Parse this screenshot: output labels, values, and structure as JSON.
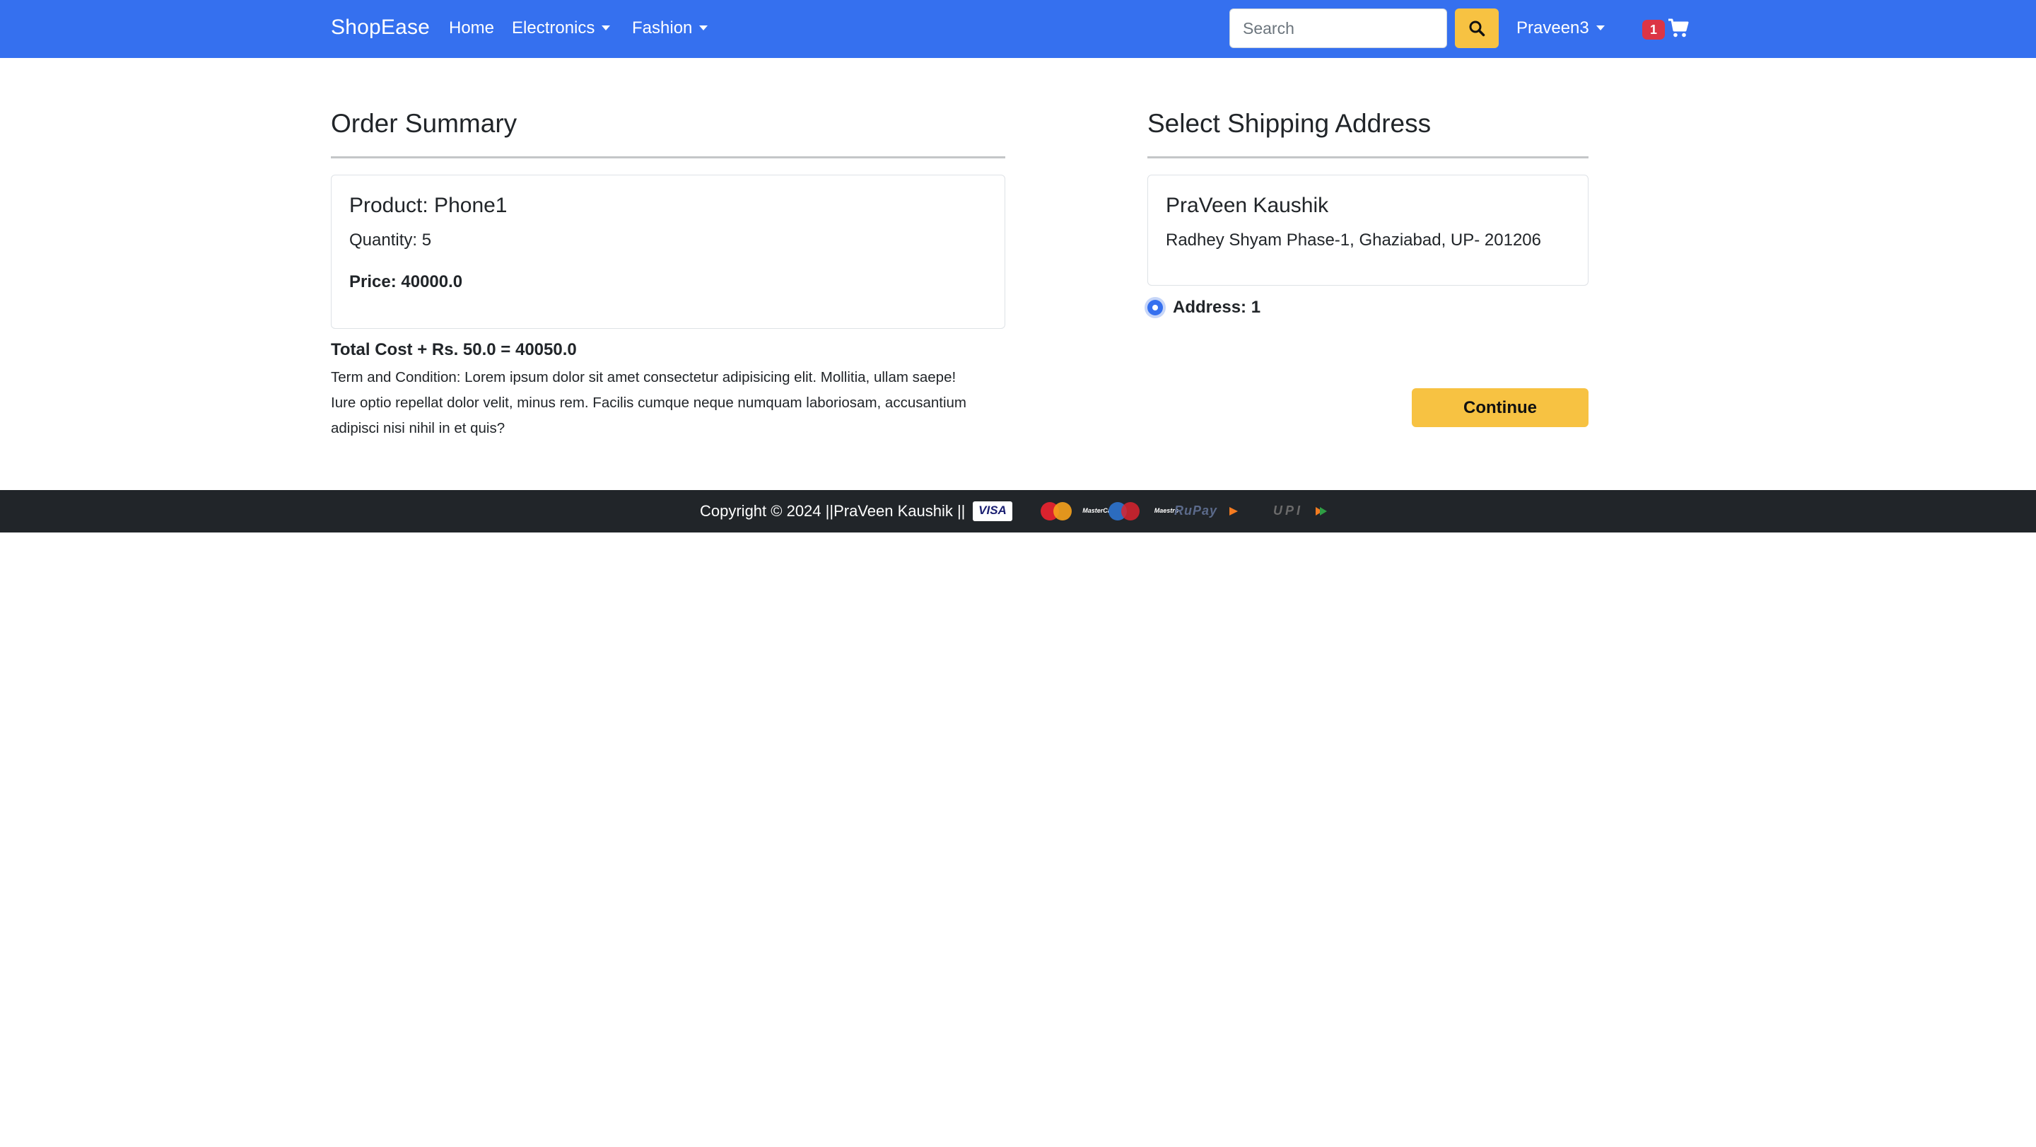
{
  "navbar": {
    "brand": "ShopEase",
    "links": [
      {
        "label": "Home"
      },
      {
        "label": "Electronics"
      },
      {
        "label": "Fashion"
      }
    ],
    "search_placeholder": "Search",
    "user_label": "Praveen3",
    "cart_count": "1",
    "color": "#3570ef",
    "accent": "#f7c242"
  },
  "order_summary": {
    "title": "Order Summary",
    "product": "Product: Phone1",
    "quantity": "Quantity: 5",
    "price": "Price: 40000.0",
    "total": "Total Cost + Rs. 50.0 = 40050.0",
    "terms_lines": [
      "Term and Condition: Lorem ipsum dolor sit amet consectetur adipisicing elit. Mollitia, ullam saepe!",
      "Iure optio repellat dolor velit, minus rem. Facilis cumque neque numquam laboriosam, accusantium",
      "adipisci nisi nihil in et quis?"
    ]
  },
  "shipping": {
    "title": "Select Shipping Address",
    "name": "PraVeen Kaushik",
    "address": "Radhey Shyam Phase-1, Ghaziabad, UP- 201206",
    "radio_label": "Address: 1",
    "continue_label": "Continue"
  },
  "footer": {
    "copyright": "Copyright © 2024 ||PraVeen Kaushik ||",
    "payment_logos": [
      {
        "name": "visa-logo",
        "text": "VISA"
      },
      {
        "name": "mastercard-logo",
        "text": "MasterCard"
      },
      {
        "name": "maestro-logo",
        "text": "Maestro"
      },
      {
        "name": "rupay-logo",
        "text": "RuPay"
      },
      {
        "name": "upi-logo",
        "text": "UPI"
      }
    ]
  }
}
